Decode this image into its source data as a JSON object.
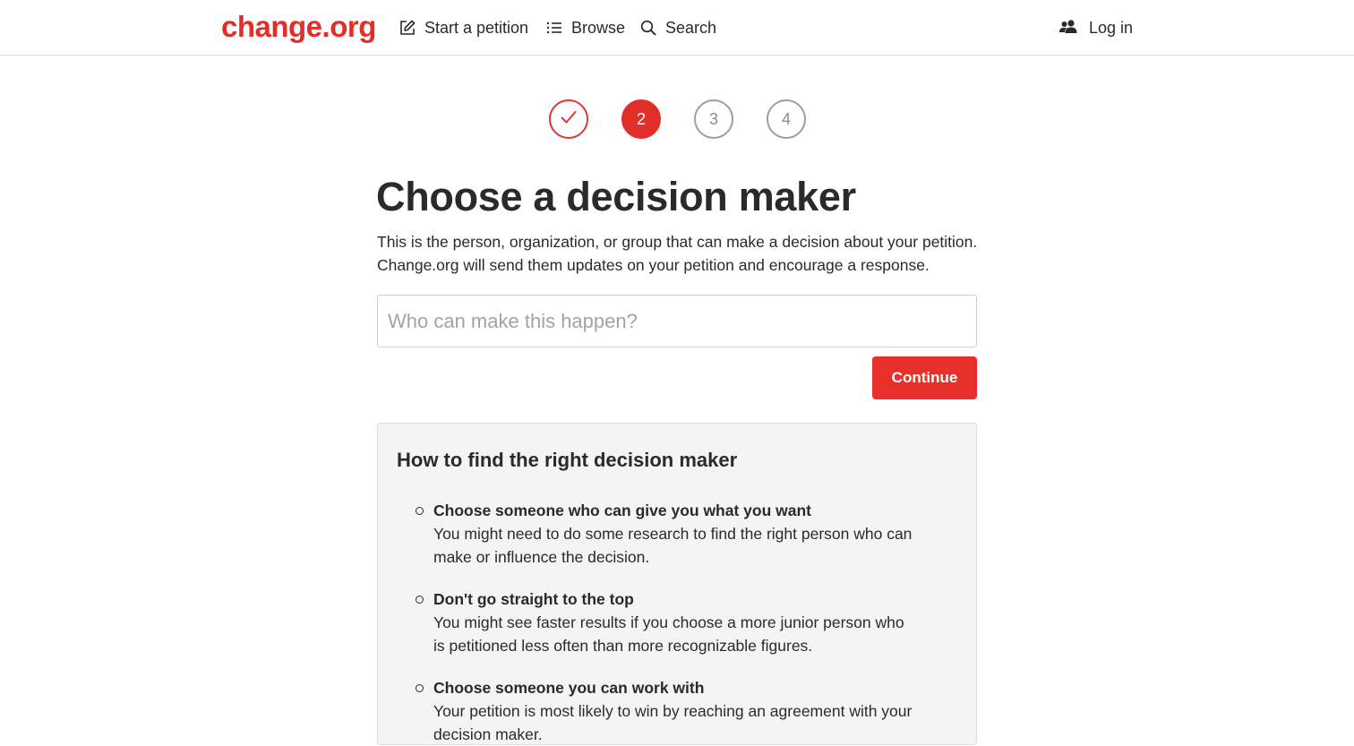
{
  "header": {
    "logo": "change.org",
    "nav": {
      "start_petition": "Start a petition",
      "browse": "Browse",
      "search": "Search",
      "login": "Log in"
    }
  },
  "stepper": {
    "current_step": 2,
    "steps": [
      {
        "label": "",
        "state": "completed"
      },
      {
        "label": "2",
        "state": "active"
      },
      {
        "label": "3",
        "state": "upcoming"
      },
      {
        "label": "4",
        "state": "upcoming"
      }
    ]
  },
  "main": {
    "title": "Choose a decision maker",
    "intro": "This is the person, organization, or group that can make a decision about your petition. Change.org will send them updates on your petition and encourage a response.",
    "input": {
      "value": "",
      "placeholder": "Who can make this happen?"
    },
    "continue_label": "Continue"
  },
  "tips": {
    "title": "How to find the right decision maker",
    "items": [
      {
        "heading": "Choose someone who can give you what you want",
        "body": "You might need to do some research to find the right person who can make or influence the decision."
      },
      {
        "heading": "Don't go straight to the top",
        "body": "You might see faster results if you choose a more junior person who is petitioned less often than more recognizable figures."
      },
      {
        "heading": "Choose someone you can work with",
        "body": "Your petition is most likely to win by reaching an agreement with your decision maker."
      }
    ]
  },
  "colors": {
    "brand": "#e02e28",
    "text": "#2b2a2a",
    "muted": "#8c8c8c",
    "panel": "#f5f4f5"
  },
  "icons": {
    "start_petition": "edit-icon",
    "browse": "list-icon",
    "search": "search-icon",
    "login": "users-icon",
    "completed_step": "checkmark-icon"
  }
}
